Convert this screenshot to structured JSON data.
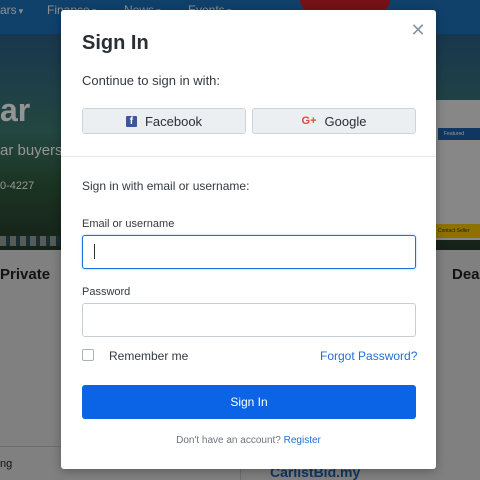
{
  "background": {
    "nav": [
      {
        "label": "ars"
      },
      {
        "label": "Finance"
      },
      {
        "label": "News"
      },
      {
        "label": "Events"
      }
    ],
    "hero_title": "ar",
    "hero_subtitle": "ar buyers",
    "hero_phone": "0-4227",
    "side_featured": "Featured",
    "side_contact": "Contact Seller",
    "section_left": "Private",
    "section_right": "Dea",
    "row_text": "ng",
    "brand": "CarlistBid.my"
  },
  "modal": {
    "title": "Sign In",
    "close_icon": "close-icon",
    "continue_text": "Continue to sign in with:",
    "facebook_label": "Facebook",
    "google_label": "Google",
    "email_intro": "Sign in with email or username:",
    "email_label": "Email or username",
    "email_value": "",
    "password_label": "Password",
    "password_value": "",
    "remember_label": "Remember me",
    "remember_checked": false,
    "forgot_label": "Forgot Password?",
    "signin_label": "Sign In",
    "no_account_text": "Don't have an account?",
    "register_label": "Register"
  },
  "colors": {
    "primary": "#0b63e5",
    "link": "#1d70d6",
    "facebook": "#3b5998",
    "google": "#dd4b39",
    "nav_bg": "#1d70b8"
  }
}
